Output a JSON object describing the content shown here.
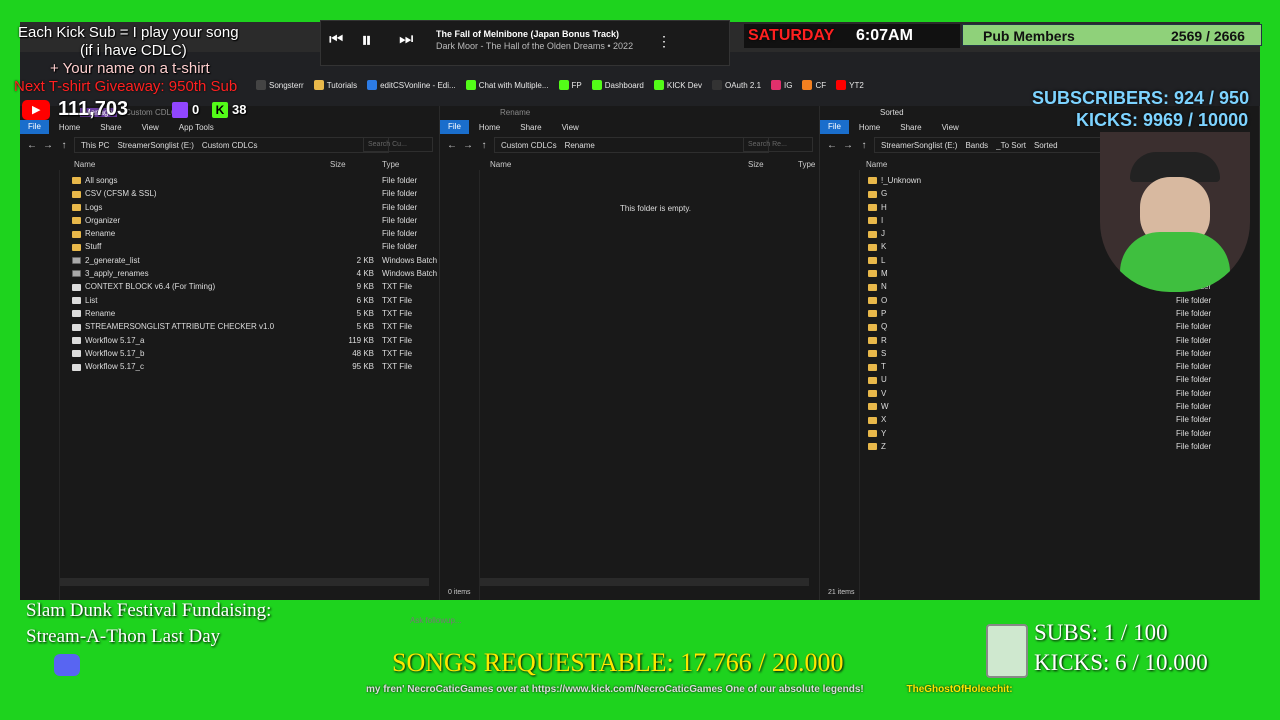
{
  "overlay": {
    "promo_line1": "Each Kick Sub = I play your song",
    "promo_line2": "(if i have CDLC)",
    "promo_line3": "+ Your name on a t-shirt",
    "promo_line4": "Next T-shirt Giveaway: 950th Sub",
    "youtube_count": "111,703",
    "twitch_count": "0",
    "kick_count": "38",
    "day": "SATURDAY",
    "time": "6:07AM",
    "pub_members_label": "Pub Members",
    "pub_members_count": "2569 / 2666",
    "subscribers": "SUBSCRIBERS: 924 / 950",
    "kicks": "KICKS: 9969 / 10000",
    "fundraiser_line1": "Slam Dunk Festival Fundaising:",
    "fundraiser_line2": "Stream-A-Thon Last Day",
    "subs_goal": "SUBS:  1 / 100",
    "kicks_goal": "KICKS: 6 / 10.000",
    "songs_requestable": "SONGS REQUESTABLE: 17.766 / 20.000",
    "ticker": "my fren' NecroCaticGames over at https://www.kick.com/NecroCaticGames One of our absolute legends!",
    "ticker_right": "TheGhostOfHoleechit:",
    "ask_followup": "Ask followup..."
  },
  "player": {
    "track": "The Fall of Melnibone (Japan Bonus Track)",
    "artist": "Dark Moor - The Hall of the Olden Dreams • 2022"
  },
  "browser": {
    "bookmarks": [
      "Songsterr",
      "Tutorials",
      "editCSVonline - Edi...",
      "Chat with Multiple...",
      "FP",
      "Dashboard",
      "KICK Dev",
      "OAuth 2.1",
      "IG",
      "CF",
      "YT2"
    ],
    "manage_label": "Manage"
  },
  "ribbon": {
    "file": "File",
    "home": "Home",
    "share": "Share",
    "view": "View",
    "app_tools": "App Tools"
  },
  "win1": {
    "title": "Custom CDLCs",
    "path": [
      "This PC",
      "StreamerSonglist (E:)",
      "Custom CDLCs"
    ],
    "search": "Search Cu...",
    "col_name": "Name",
    "col_size": "Size",
    "col_type": "Type",
    "files": [
      {
        "name": "All songs",
        "size": "",
        "type": "File folder",
        "kind": "folder"
      },
      {
        "name": "CSV (CFSM & SSL)",
        "size": "",
        "type": "File folder",
        "kind": "folder"
      },
      {
        "name": "Logs",
        "size": "",
        "type": "File folder",
        "kind": "folder"
      },
      {
        "name": "Organizer",
        "size": "",
        "type": "File folder",
        "kind": "folder"
      },
      {
        "name": "Rename",
        "size": "",
        "type": "File folder",
        "kind": "folder"
      },
      {
        "name": "Stuff",
        "size": "",
        "type": "File folder",
        "kind": "folder"
      },
      {
        "name": "2_generate_list",
        "size": "2 KB",
        "type": "Windows Batch",
        "kind": "bat"
      },
      {
        "name": "3_apply_renames",
        "size": "4 KB",
        "type": "Windows Batch",
        "kind": "bat"
      },
      {
        "name": "CONTEXT BLOCK v6.4 (For Timing)",
        "size": "9 KB",
        "type": "TXT File",
        "kind": "txt"
      },
      {
        "name": "List",
        "size": "6 KB",
        "type": "TXT File",
        "kind": "txt"
      },
      {
        "name": "Rename",
        "size": "5 KB",
        "type": "TXT File",
        "kind": "txt"
      },
      {
        "name": "STREAMERSONGLIST ATTRIBUTE CHECKER v1.0",
        "size": "5 KB",
        "type": "TXT File",
        "kind": "txt"
      },
      {
        "name": "Workflow 5.17_a",
        "size": "119 KB",
        "type": "TXT File",
        "kind": "txt"
      },
      {
        "name": "Workflow 5.17_b",
        "size": "48 KB",
        "type": "TXT File",
        "kind": "txt"
      },
      {
        "name": "Workflow 5.17_c",
        "size": "95 KB",
        "type": "TXT File",
        "kind": "txt"
      }
    ]
  },
  "win2": {
    "title": "Rename",
    "path": [
      "Custom CDLCs",
      "Rename"
    ],
    "search": "Search Re...",
    "col_name": "Name",
    "col_size": "Size",
    "col_type": "Type",
    "empty": "This folder is empty.",
    "status": "0 items"
  },
  "win3": {
    "title": "Sorted",
    "path": [
      "StreamerSonglist (E:)",
      "Bands",
      "_To Sort",
      "Sorted"
    ],
    "col_name": "Name",
    "status": "21 items",
    "folders": [
      {
        "name": "!_Unknown",
        "type": ""
      },
      {
        "name": "G",
        "type": ""
      },
      {
        "name": "H",
        "type": ""
      },
      {
        "name": "I",
        "type": ""
      },
      {
        "name": "J",
        "type": ""
      },
      {
        "name": "K",
        "type": ""
      },
      {
        "name": "L",
        "type": ""
      },
      {
        "name": "M",
        "type": "File folder"
      },
      {
        "name": "N",
        "type": "File folder"
      },
      {
        "name": "O",
        "type": "File folder"
      },
      {
        "name": "P",
        "type": "File folder"
      },
      {
        "name": "Q",
        "type": "File folder"
      },
      {
        "name": "R",
        "type": "File folder"
      },
      {
        "name": "S",
        "type": "File folder"
      },
      {
        "name": "T",
        "type": "File folder"
      },
      {
        "name": "U",
        "type": "File folder"
      },
      {
        "name": "V",
        "type": "File folder"
      },
      {
        "name": "W",
        "type": "File folder"
      },
      {
        "name": "X",
        "type": "File folder"
      },
      {
        "name": "Y",
        "type": "File folder"
      },
      {
        "name": "Z",
        "type": "File folder"
      }
    ]
  },
  "colors": {
    "green_screen": "#1ed31e",
    "explorer_bg": "#191919",
    "folder": "#e8b84a",
    "file_tab": "#1a6ecc",
    "accent_red": "#ff2020"
  }
}
